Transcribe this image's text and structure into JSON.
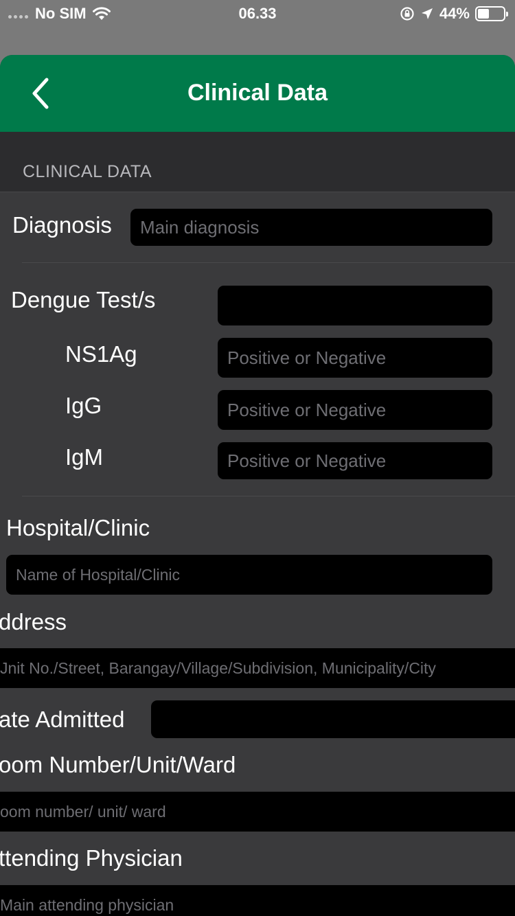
{
  "status_bar": {
    "carrier": "No SIM",
    "time": "06.33",
    "battery": "44%",
    "battery_level": 0.44
  },
  "nav": {
    "title": "Clinical Data",
    "back_icon": "chevron-left-icon"
  },
  "section": {
    "header": "CLINICAL DATA"
  },
  "form": {
    "diagnosis": {
      "label": "Diagnosis",
      "placeholder": "Main diagnosis"
    },
    "dengue": {
      "label": "Dengue Test/s",
      "ns1ag": {
        "label": "NS1Ag",
        "placeholder": "Positive or Negative"
      },
      "igg": {
        "label": "IgG",
        "placeholder": "Positive or Negative"
      },
      "igm": {
        "label": "IgM",
        "placeholder": "Positive or Negative"
      }
    },
    "hospital": {
      "label": "Hospital/Clinic",
      "placeholder": "Name of Hospital/Clinic"
    },
    "address": {
      "label": "ddress",
      "placeholder": "Jnit No./Street, Barangay/Village/Subdivision, Municipality/City"
    },
    "date_admitted": {
      "label": "ate Admitted"
    },
    "room": {
      "label": "oom Number/Unit/Ward",
      "placeholder": "oom number/ unit/ ward"
    },
    "physician": {
      "label": "ttending Physician",
      "placeholder": "Main attending physician"
    }
  },
  "colors": {
    "nav_green": "#007a4a",
    "background": "#3a3a3c",
    "field": "#000000"
  }
}
